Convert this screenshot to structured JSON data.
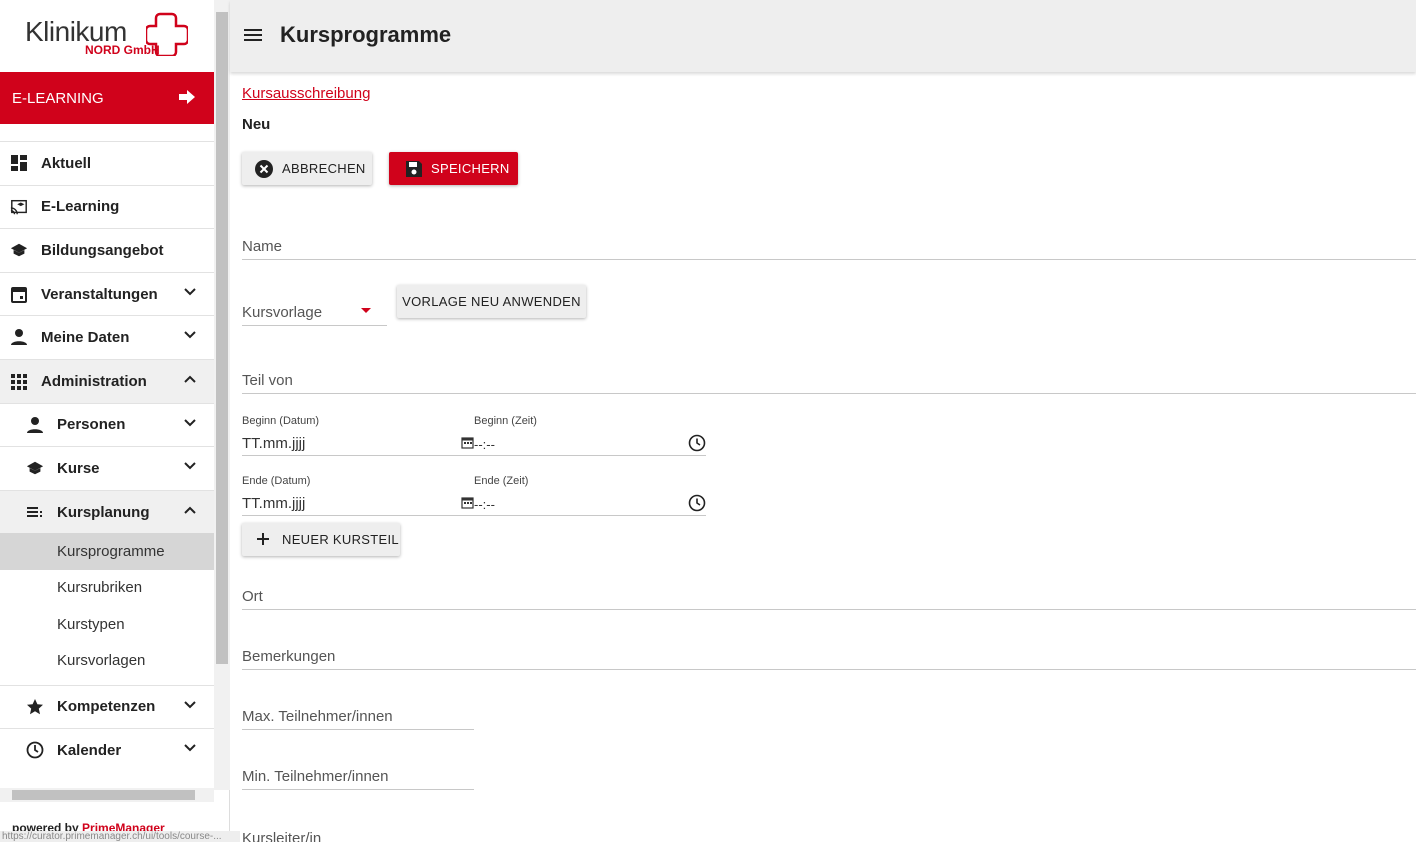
{
  "brand": {
    "name": "Klinikum",
    "sub": "NORD GmbH",
    "accent": "#d0021b"
  },
  "elearning_button": {
    "label": "E-LEARNING"
  },
  "nav": {
    "aktuell": "Aktuell",
    "elearning": "E-Learning",
    "bildungsangebot": "Bildungsangebot",
    "veranstaltungen": "Veranstaltungen",
    "meine_daten": "Meine Daten",
    "administration": "Administration",
    "personen": "Personen",
    "kurse": "Kurse",
    "kursplanung": "Kursplanung",
    "kursprogramme": "Kursprogramme",
    "kursrubriken": "Kursrubriken",
    "kurstypen": "Kurstypen",
    "kursvorlagen": "Kursvorlagen",
    "kompetenzen": "Kompetenzen",
    "kalender": "Kalender"
  },
  "footer": {
    "powered_by": "powered by ",
    "powered_link": "PrimeManager",
    "status_url": "https://curator.primemanager.ch/ui/tools/course-..."
  },
  "header": {
    "title": "Kursprogramme"
  },
  "main": {
    "breadcrumb": "Kursausschreibung",
    "subtitle": "Neu",
    "cancel_label": "ABBRECHEN",
    "save_label": "SPEICHERN",
    "name_label": "Name",
    "kursvorlage_label": "Kursvorlage",
    "vorlage_button": "VORLAGE NEU ANWENDEN",
    "teil_von_label": "Teil von",
    "beginn_datum_label": "Beginn (Datum)",
    "beginn_zeit_label": "Beginn (Zeit)",
    "beginn_datum_value": "TT.mm.jjjj",
    "beginn_zeit_value": "--:--",
    "ende_datum_label": "Ende (Datum)",
    "ende_zeit_label": "Ende (Zeit)",
    "ende_datum_value": "TT.mm.jjjj",
    "ende_zeit_value": "--:--",
    "neuer_kursteil": "NEUER KURSTEIL",
    "ort_label": "Ort",
    "bemerkungen_label": "Bemerkungen",
    "max_label": "Max. Teilnehmer/innen",
    "min_label": "Min. Teilnehmer/innen",
    "kursleiter_label": "Kursleiter/in"
  }
}
